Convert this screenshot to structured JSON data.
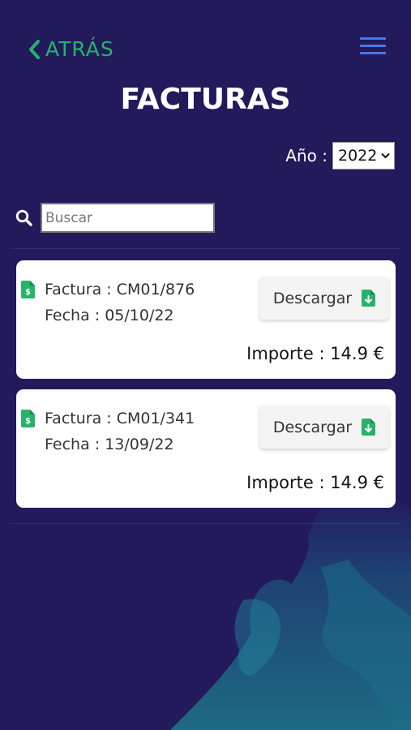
{
  "header": {
    "back_label": "ATRÁS",
    "title": "FACTURAS"
  },
  "filters": {
    "year_label": "Año :",
    "year_value": "2022",
    "search_placeholder": "Buscar",
    "search_value": ""
  },
  "invoices": [
    {
      "invoice_label": "Factura : CM01/876",
      "date_label": "Fecha : 05/10/22",
      "download_label": "Descargar",
      "amount_label": "Importe : 14.9 €"
    },
    {
      "invoice_label": "Factura : CM01/341",
      "date_label": "Fecha : 13/09/22",
      "download_label": "Descargar",
      "amount_label": "Importe : 14.9 €"
    }
  ],
  "colors": {
    "background": "#231a5c",
    "accent_green": "#27b36a",
    "menu_blue": "#4a78e8"
  },
  "icons": [
    "chevron-left-icon",
    "hamburger-menu-icon",
    "search-icon",
    "invoice-dollar-file-icon",
    "file-download-icon",
    "chevron-down-icon"
  ]
}
